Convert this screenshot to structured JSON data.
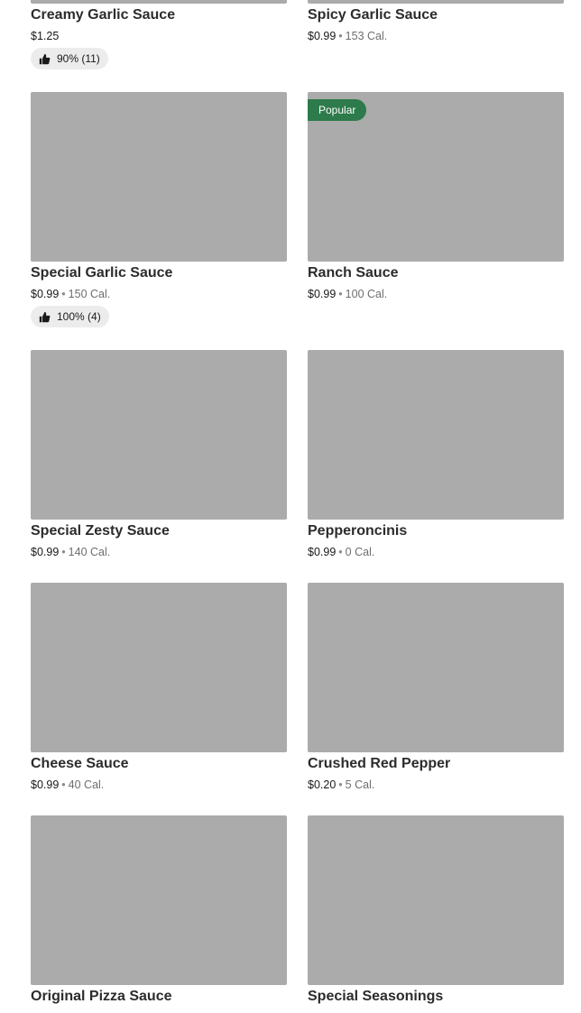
{
  "items": [
    {
      "name": "Creamy Garlic Sauce",
      "price": "$1.25",
      "calories": "",
      "rating": "90% (11)",
      "badge": ""
    },
    {
      "name": "Spicy Garlic Sauce",
      "price": "$0.99",
      "calories": "153 Cal.",
      "rating": "",
      "badge": ""
    },
    {
      "name": "Special Garlic Sauce",
      "price": "$0.99",
      "calories": "150 Cal.",
      "rating": "100% (4)",
      "badge": ""
    },
    {
      "name": "Ranch Sauce",
      "price": "$0.99",
      "calories": "100 Cal.",
      "rating": "",
      "badge": "Popular"
    },
    {
      "name": "Special Zesty Sauce",
      "price": "$0.99",
      "calories": "140 Cal.",
      "rating": "",
      "badge": ""
    },
    {
      "name": "Pepperoncinis",
      "price": "$0.99",
      "calories": "0 Cal.",
      "rating": "",
      "badge": ""
    },
    {
      "name": "Cheese Sauce",
      "price": "$0.99",
      "calories": "40 Cal.",
      "rating": "",
      "badge": ""
    },
    {
      "name": "Crushed Red Pepper",
      "price": "$0.20",
      "calories": "5 Cal.",
      "rating": "",
      "badge": ""
    },
    {
      "name": "Original Pizza Sauce",
      "price": "",
      "calories": "",
      "rating": "",
      "badge": ""
    },
    {
      "name": "Special Seasonings",
      "price": "",
      "calories": "",
      "rating": "",
      "badge": ""
    }
  ],
  "separator": "•",
  "icons": {
    "rating": "thumbs-up-icon"
  },
  "colors": {
    "badge": "#2d7a4a",
    "image_placeholder": "#ababab",
    "pill_bg": "#ececec"
  }
}
